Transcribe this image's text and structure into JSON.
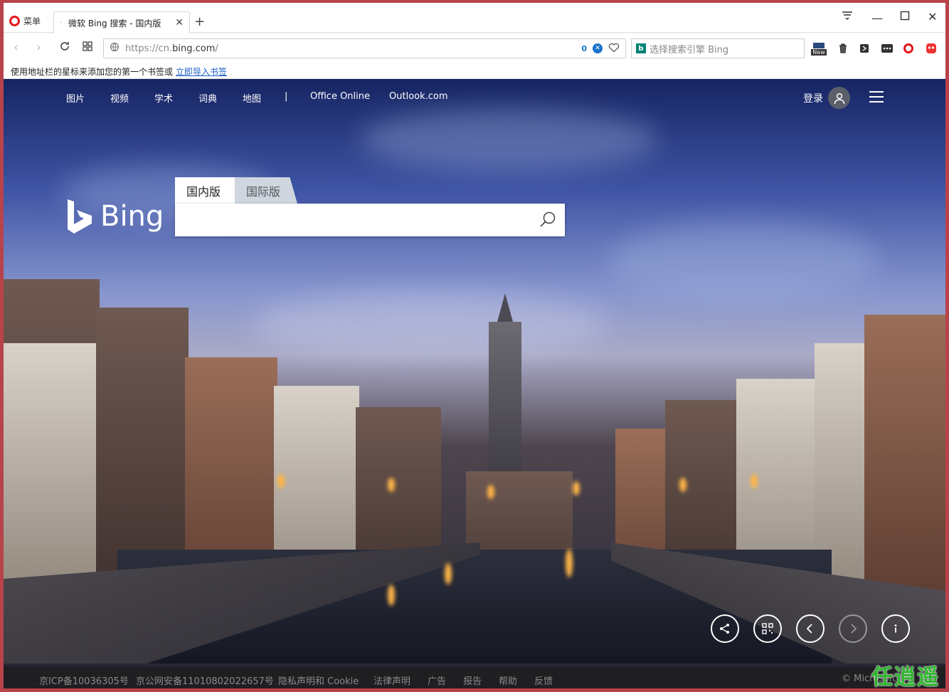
{
  "browser": {
    "menu_label": "菜单",
    "tab_title": "微软 Bing 搜索 - 国内版",
    "new_tab": "+",
    "url_prefix": "https://cn.",
    "url_domain": "bing.com",
    "url_suffix": "/",
    "adblock_count": "0",
    "search_placeholder": "选择搜索引擎 Bing",
    "ext_new_label": "New",
    "bookmark_hint": "使用地址栏的星标来添加您的第一个书签或",
    "bookmark_import_link": "立即导入书签"
  },
  "bing": {
    "nav": [
      "图片",
      "视频",
      "学术",
      "词典",
      "地图",
      "|",
      "Office Online",
      "Outlook.com"
    ],
    "login": "登录",
    "logo_text": "Bing",
    "tabs": [
      "国内版",
      "国际版"
    ],
    "search_value": ""
  },
  "footer": {
    "items": [
      "京ICP备10036305号",
      "京公网安备11010802022657号",
      "隐私声明和 Cookie",
      "法律声明",
      "广告",
      "报告",
      "帮助",
      "反馈"
    ],
    "copyright": "© Microsoft"
  },
  "watermark": "任逍遥",
  "colors": {
    "window_border": "#b8434a",
    "opera_red": "#e3151a",
    "link_blue": "#1a5cc8",
    "bing_teal": "#008373"
  }
}
